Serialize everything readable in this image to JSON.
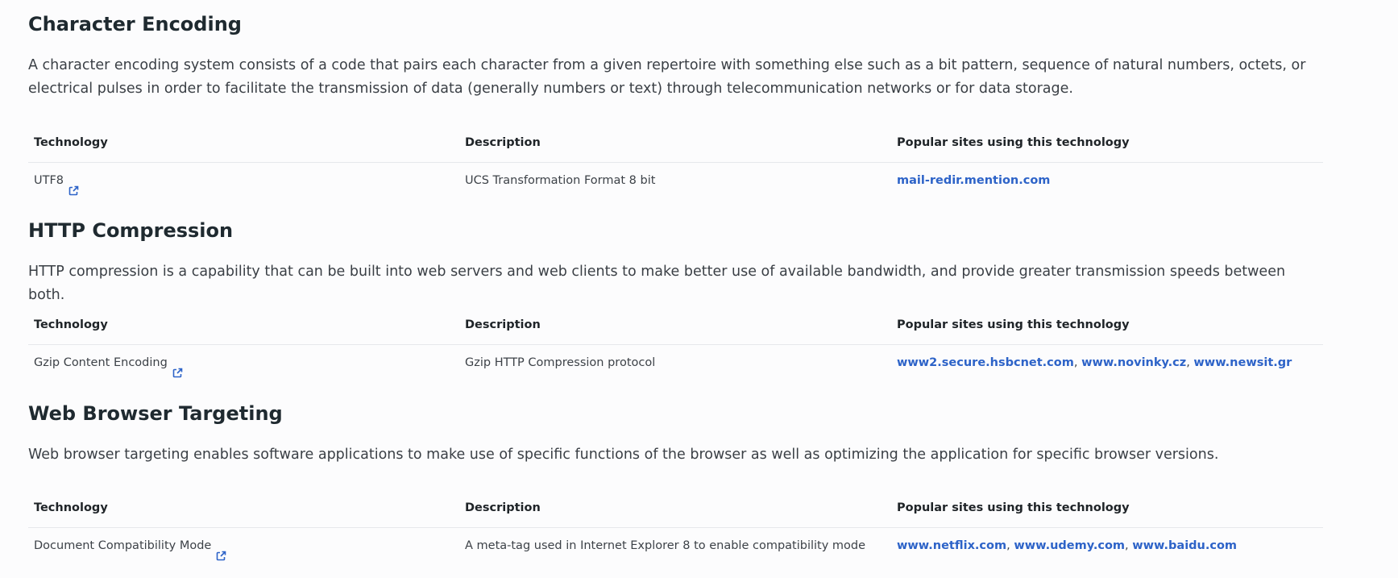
{
  "table_headers": {
    "technology": "Technology",
    "description": "Description",
    "popular_sites": "Popular sites using this technology"
  },
  "sections": [
    {
      "title": "Character Encoding",
      "description": "A character encoding system consists of a code that pairs each character from a given repertoire with something else such as a bit pattern, sequence of natural numbers, octets, or electrical pulses in order to facilitate the transmission of data (generally numbers or text) through telecommunication networks or for data storage.",
      "rows": [
        {
          "technology": "UTF8",
          "description": "UCS Transformation Format 8 bit",
          "sites": [
            "mail-redir.mention.com"
          ]
        }
      ]
    },
    {
      "title": "HTTP Compression",
      "description": "HTTP compression is a capability that can be built into web servers and web clients to make better use of available bandwidth, and provide greater transmission speeds between both.",
      "rows": [
        {
          "technology": "Gzip Content Encoding",
          "description": "Gzip HTTP Compression protocol",
          "sites": [
            "www2.secure.hsbcnet.com",
            "www.novinky.cz",
            "www.newsit.gr"
          ]
        }
      ]
    },
    {
      "title": "Web Browser Targeting",
      "description": "Web browser targeting enables software applications to make use of specific functions of the browser as well as optimizing the application for specific browser versions.",
      "rows": [
        {
          "technology": "Document Compatibility Mode",
          "description": "A meta-tag used in Internet Explorer 8 to enable compatibility mode",
          "sites": [
            "www.netflix.com",
            "www.udemy.com",
            "www.baidu.com"
          ]
        }
      ]
    }
  ],
  "icons": {
    "external_link": "external-link-icon"
  },
  "colors": {
    "link": "#2d63c8",
    "heading": "#1f2a30",
    "body_text": "#3a3f45",
    "divider": "#e6e8eb",
    "background": "#fcfcfd"
  }
}
